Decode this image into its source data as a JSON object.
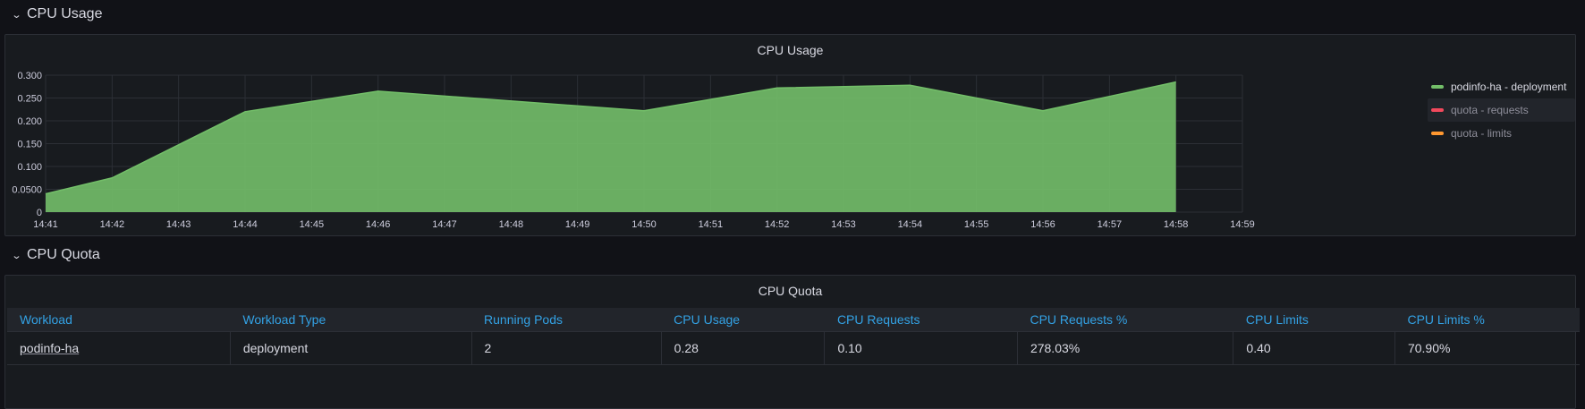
{
  "rows": {
    "cpu_usage": {
      "label": "CPU Usage"
    },
    "cpu_quota": {
      "label": "CPU Quota"
    }
  },
  "cpu_usage_panel": {
    "title": "CPU Usage"
  },
  "legend": [
    {
      "label": "podinfo-ha - deployment",
      "color": "#73bf69",
      "active": true
    },
    {
      "label": "quota - requests",
      "color": "#f2495c",
      "active": false
    },
    {
      "label": "quota - limits",
      "color": "#ff9830",
      "active": false
    }
  ],
  "chart_data": {
    "type": "area",
    "x": [
      "14:41",
      "14:42",
      "14:43",
      "14:44",
      "14:45",
      "14:46",
      "14:47",
      "14:48",
      "14:49",
      "14:50",
      "14:51",
      "14:52",
      "14:53",
      "14:54",
      "14:55",
      "14:56",
      "14:57",
      "14:58",
      "14:59"
    ],
    "series": [
      {
        "name": "podinfo-ha - deployment",
        "color": "#73bf69",
        "points": [
          [
            "14:41",
            0.04
          ],
          [
            "14:42",
            0.075
          ],
          [
            "14:44",
            0.22
          ],
          [
            "14:46",
            0.265
          ],
          [
            "14:50",
            0.222
          ],
          [
            "14:52",
            0.272
          ],
          [
            "14:54",
            0.278
          ],
          [
            "14:56",
            0.222
          ],
          [
            "14:58",
            0.285
          ]
        ]
      }
    ],
    "yticks": [
      "0",
      "0.0500",
      "0.100",
      "0.150",
      "0.200",
      "0.250",
      "0.300"
    ],
    "ylim": [
      0,
      0.3
    ],
    "grid": true,
    "legend_position": "right"
  },
  "cpu_quota_panel": {
    "title": "CPU Quota"
  },
  "table": {
    "columns": [
      "Workload",
      "Workload Type",
      "Running Pods",
      "CPU Usage",
      "CPU Requests",
      "CPU Requests %",
      "CPU Limits",
      "CPU Limits %"
    ],
    "rows": [
      [
        "podinfo-ha",
        "deployment",
        "2",
        "0.28",
        "0.10",
        "278.03%",
        "0.40",
        "70.90%"
      ]
    ]
  }
}
